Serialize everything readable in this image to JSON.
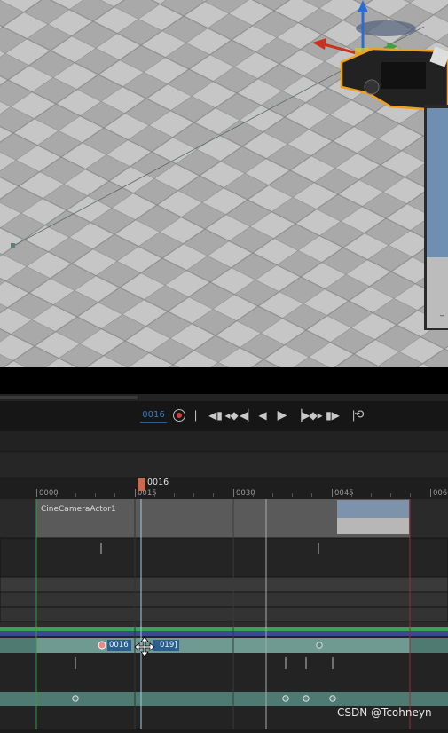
{
  "viewport": {
    "description": "3D viewport with checker floor and cine camera actor",
    "gizmo_icon": "transform-gizmo-icon",
    "camera_icon": "cine-camera-icon"
  },
  "transport": {
    "current_frame": "0016",
    "buttons": [
      {
        "name": "record-button",
        "icon": "record-icon",
        "glyph": ""
      },
      {
        "name": "jump-start-button",
        "icon": "jump-to-start-icon",
        "glyph": "⎸"
      },
      {
        "name": "step-back-key-button",
        "icon": "previous-key-icon",
        "glyph": "◀▮"
      },
      {
        "name": "prev-keyframe-button",
        "icon": "prev-keyframe-icon",
        "glyph": "◂◆"
      },
      {
        "name": "step-back-frame-button",
        "icon": "step-back-icon",
        "glyph": "◀▏"
      },
      {
        "name": "play-reverse-button",
        "icon": "play-reverse-icon",
        "glyph": "◀"
      },
      {
        "name": "play-button",
        "icon": "play-icon",
        "glyph": "▶"
      },
      {
        "name": "step-forward-frame-button",
        "icon": "step-forward-icon",
        "glyph": "▕▶"
      },
      {
        "name": "next-keyframe-button",
        "icon": "next-keyframe-icon",
        "glyph": "◆▸"
      },
      {
        "name": "step-forward-key-button",
        "icon": "next-key-icon",
        "glyph": "▮▶"
      },
      {
        "name": "jump-end-button",
        "icon": "jump-to-end-icon",
        "glyph": "⎹"
      },
      {
        "name": "loop-button",
        "icon": "loop-icon",
        "glyph": "⟲"
      }
    ]
  },
  "ruler": {
    "playhead_label": "0016",
    "ticks": [
      "0000",
      "0015",
      "0030",
      "0045",
      "0060"
    ]
  },
  "tracks": {
    "camera_section_label": "CineCameraActor1",
    "selected_key_label": "0016",
    "range_end_label": "019]"
  },
  "watermark": "CSDN @Tcohneyn"
}
